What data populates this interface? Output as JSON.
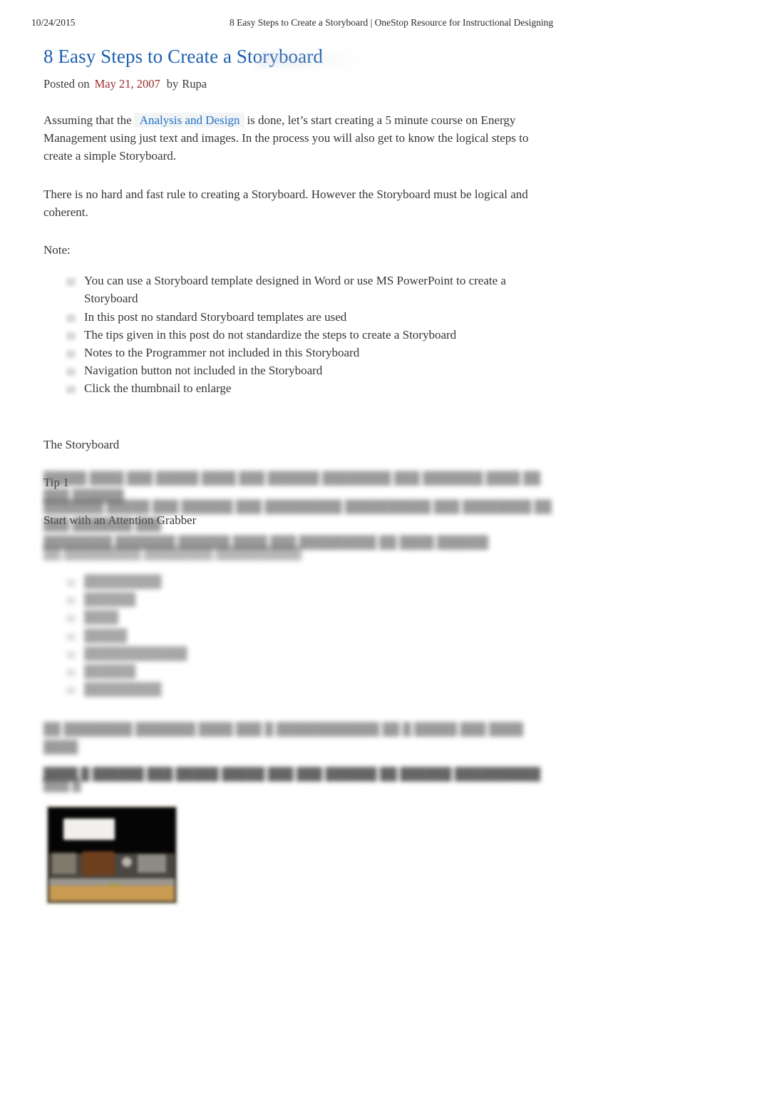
{
  "print_header": {
    "date": "10/24/2015",
    "title": "8 Easy Steps to Create a Storyboard | OneStop Resource for Instructional Designing"
  },
  "post": {
    "title": "8 Easy Steps to Create a Storyboard",
    "meta": {
      "posted_on_label": "Posted on",
      "date": "May 21, 2007",
      "by_label": "by",
      "author": "Rupa"
    },
    "paragraph_1": {
      "before_link": "Assuming that the",
      "link_text": "Analysis and Design",
      "after_link": "is done, let’s start creating a 5 minute course on Energy Management using just text and images. In the process you will also get to know the logical steps to create a simple Storyboard."
    },
    "paragraph_2": "There is no hard and fast rule to creating a Storyboard. However the Storyboard must be logical and coherent.",
    "note_label": "Note:",
    "note_items": [
      "You can use a Storyboard template designed in Word or use MS PowerPoint to create a Storyboard",
      "In this post no standard Storyboard templates are used",
      "The tips given in this post do not standardize the steps to create a Storyboard",
      "Notes to the Programmer not included in this Storyboard",
      "Navigation button not included in the Storyboard",
      "Click the thumbnail to enlarge"
    ],
    "section_storyboard": "The Storyboard",
    "tip_1_label": "Tip 1",
    "tip_1_heading": "Start with an Attention Grabber",
    "obscured": {
      "paragraph_a_line_1": "█████ ████ ███ █████ ████ ███ ██████ ████████ ███ ███████ ████ ██ ███ ██████",
      "paragraph_b_line_1": "███████ █████ ███ ██████ ███ █████████ ██████████ ███ ████████ ██ ███ ███████ ███",
      "paragraph_b_line_2": "████████ ███████ ██████ ████ ███ █████████ ██ ████ ██████",
      "paragraph_c": "██ █████████ ████████ ██████████",
      "list_items": [
        "█████████",
        "██████",
        "████",
        "█████",
        "████████████",
        "██████",
        "█████████"
      ],
      "paragraph_d_line_1": "██ ████████ ███████ ████ ███ █ ████████████ ██ █ █████ ███ ████ ████",
      "paragraph_d_line_2": "████ █ ██████ ███ █████ █████ ███ ███ ██████ ██ ██████ ██████████",
      "tip_2_label": "███ █"
    },
    "thumbnail_alt": "storyboard-slide-thumbnail"
  }
}
